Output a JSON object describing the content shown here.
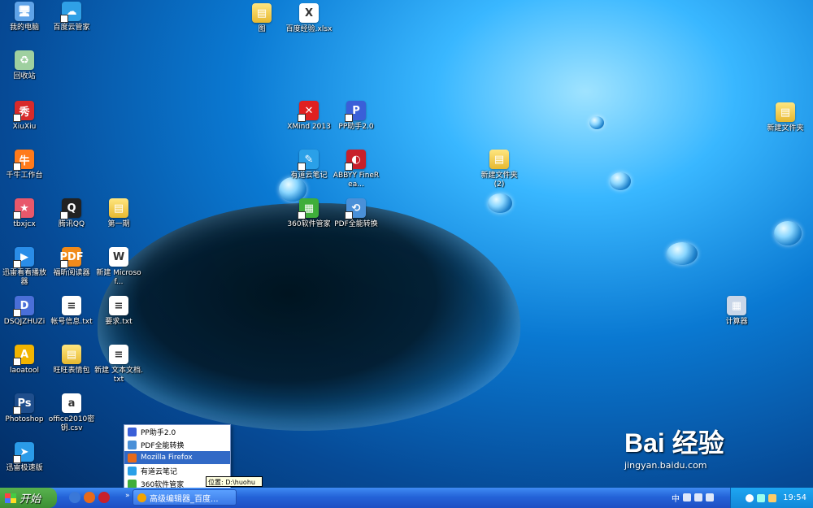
{
  "desktop_icons": [
    {
      "id": "my-computer",
      "label": "我的电脑",
      "color": "#5fa3e8",
      "glyph": "🖥"
    },
    {
      "id": "recycle-bin",
      "label": "回收站",
      "color": "#9fd0a0",
      "glyph": "♻"
    },
    {
      "id": "xiuxiu",
      "label": "XiuXiu",
      "color": "#d82a2a",
      "glyph": "秀"
    },
    {
      "id": "qianniu",
      "label": "千牛工作台",
      "color": "#ff7a1a",
      "glyph": "牛"
    },
    {
      "id": "tbxjcx",
      "label": "tbxjcx",
      "color": "#e8586b",
      "glyph": "★"
    },
    {
      "id": "xunlei-player",
      "label": "迅雷看看播放器",
      "color": "#2a8de8",
      "glyph": "▶"
    },
    {
      "id": "dsqjzhuzi",
      "label": "DSQJZHUZi",
      "color": "#4a6fd8",
      "glyph": "D"
    },
    {
      "id": "laoatool",
      "label": "laoatool",
      "color": "#f2b400",
      "glyph": "A"
    },
    {
      "id": "photoshop",
      "label": "Photoshop",
      "color": "#1f4e8c",
      "glyph": "Ps"
    },
    {
      "id": "xunlei-speed",
      "label": "迅雷极速版",
      "color": "#2a9be8",
      "glyph": "➤"
    },
    {
      "id": "baidu-cloud",
      "label": "百度云管家",
      "color": "#2fa0e6",
      "glyph": "☁"
    },
    {
      "id": "qq",
      "label": "腾讯QQ",
      "color": "#222",
      "glyph": "Q"
    },
    {
      "id": "foxit",
      "label": "福昕阅读器",
      "color": "#f08a1a",
      "glyph": "PDF"
    },
    {
      "id": "account-info",
      "label": "帐号信息.txt",
      "color": "#ffffff",
      "glyph": "≡"
    },
    {
      "id": "wangwang",
      "label": "旺旺表情包",
      "color": "#f2c230",
      "glyph": "▤"
    },
    {
      "id": "office-key",
      "label": "office2010密钥.csv",
      "color": "#ffffff",
      "glyph": "a"
    },
    {
      "id": "folder-1",
      "label": "第一期",
      "color": "#f2c230",
      "glyph": "▤"
    },
    {
      "id": "new-microsoft",
      "label": "新建 Microsof...",
      "color": "#ffffff",
      "glyph": "W"
    },
    {
      "id": "requirements",
      "label": "要求.txt",
      "color": "#ffffff",
      "glyph": "≡"
    },
    {
      "id": "new-text",
      "label": "新建 文本文档.txt",
      "color": "#ffffff",
      "glyph": "≡"
    },
    {
      "id": "folder-tu",
      "label": "图",
      "color": "#f2c230",
      "glyph": "▤"
    },
    {
      "id": "baidu-exp",
      "label": "百度经验.xlsx",
      "color": "#ffffff",
      "glyph": "X"
    },
    {
      "id": "xmind",
      "label": "XMind 2013",
      "color": "#e02020",
      "glyph": "✕"
    },
    {
      "id": "pp-helper",
      "label": "PP助手2.0",
      "color": "#3a5fd8",
      "glyph": "P"
    },
    {
      "id": "youdao",
      "label": "有道云笔记",
      "color": "#2aa0e8",
      "glyph": "✎"
    },
    {
      "id": "abbyy",
      "label": "ABBYY FineRea...",
      "color": "#c8202a",
      "glyph": "◐"
    },
    {
      "id": "360-manager",
      "label": "360软件管家",
      "color": "#3fae3a",
      "glyph": "▦"
    },
    {
      "id": "pdf-convert",
      "label": "PDF全能转换",
      "color": "#4a90d8",
      "glyph": "⟲"
    },
    {
      "id": "new-folder-2",
      "label": "新建文件夹 (2)",
      "color": "#f2c230",
      "glyph": "▤"
    },
    {
      "id": "new-folder",
      "label": "新建文件夹",
      "color": "#f2c230",
      "glyph": "▤"
    },
    {
      "id": "calculator",
      "label": "计算器",
      "color": "#c9d6e8",
      "glyph": "▦"
    }
  ],
  "taskbar": {
    "start_label": "开始",
    "active_task": "高级编辑器_百度...",
    "chevron": "»",
    "tray_time": "19:54",
    "lang": "中"
  },
  "popup_menu": {
    "items": [
      {
        "label": "PP助手2.0",
        "color": "#3a5fd8",
        "selected": false
      },
      {
        "label": "PDF全能转换",
        "color": "#4a90d8",
        "selected": false
      },
      {
        "label": "Mozilla Firefox",
        "color": "#e86a1a",
        "selected": true
      },
      {
        "label": "有道云笔记",
        "color": "#2aa0e8",
        "selected": false
      },
      {
        "label": "360软件管家",
        "color": "#3fae3a",
        "selected": false
      }
    ],
    "tooltip": "位置: D:\\huohu"
  },
  "watermark": {
    "brand": "Bai 经验",
    "url": "jingyan.baidu.com"
  }
}
